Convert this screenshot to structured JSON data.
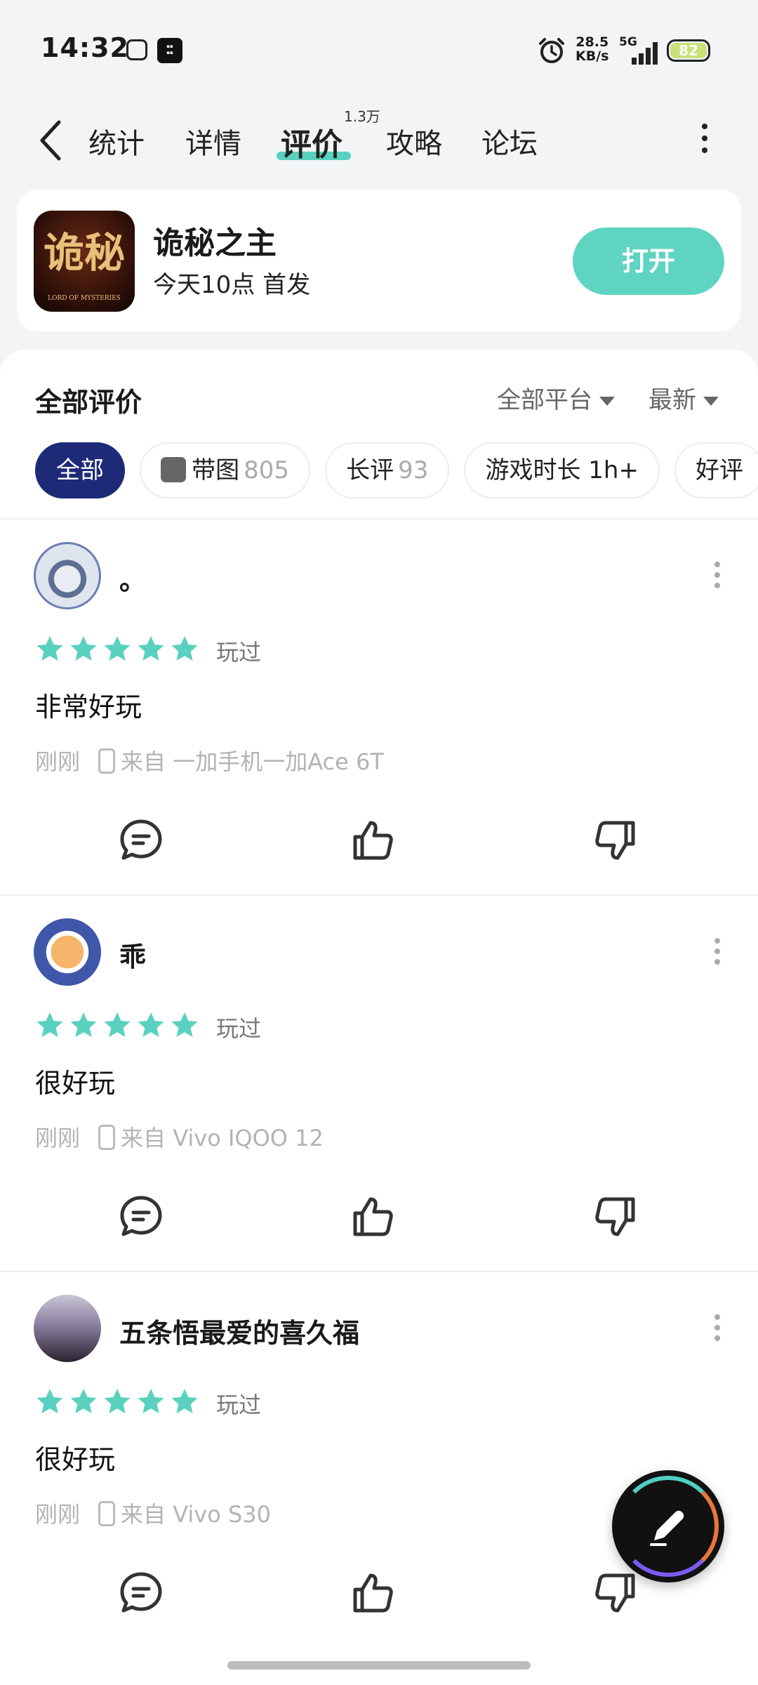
{
  "status_bar": {
    "time": "14:32",
    "net_speed_value": "28.5",
    "net_speed_unit": "KB/s",
    "network": "5G",
    "battery": "82",
    "icons": [
      "sync-icon",
      "lynk-co-icon",
      "alarm-icon",
      "signal-icon",
      "battery-icon"
    ]
  },
  "nav": {
    "tabs": [
      {
        "label": "统计"
      },
      {
        "label": "详情"
      },
      {
        "label": "评价",
        "badge": "1.3万",
        "active": true
      },
      {
        "label": "攻略"
      },
      {
        "label": "论坛"
      }
    ]
  },
  "game": {
    "title": "诡秘之主",
    "subtitle": "今天10点 首发",
    "icon_text": "诡秘",
    "icon_subtext": "LORD OF MYSTERIES",
    "open_label": "打开"
  },
  "reviews": {
    "heading": "全部评价",
    "platform_filter": "全部平台",
    "sort_filter": "最新",
    "chips": [
      {
        "label": "全部",
        "active": true
      },
      {
        "label": "带图",
        "count": "805"
      },
      {
        "label": "长评",
        "count": "93"
      },
      {
        "label": "游戏时长 1h+"
      },
      {
        "label": "好评"
      }
    ],
    "items": [
      {
        "user": "。",
        "rating": 5,
        "played": "玩过",
        "text": "非常好玩",
        "time": "刚刚",
        "device": "来自 一加手机一加Ace 6T"
      },
      {
        "user": "乖",
        "rating": 5,
        "played": "玩过",
        "text": "很好玩",
        "time": "刚刚",
        "device": "来自 Vivo IQOO 12"
      },
      {
        "user": "五条悟最爱的喜久福",
        "rating": 5,
        "played": "玩过",
        "text": "很好玩",
        "time": "刚刚",
        "device": "来自 Vivo S30"
      }
    ]
  },
  "colors": {
    "accent": "#5fd4c1",
    "active_chip": "#1e2a78",
    "star": "#5ad1bf"
  }
}
